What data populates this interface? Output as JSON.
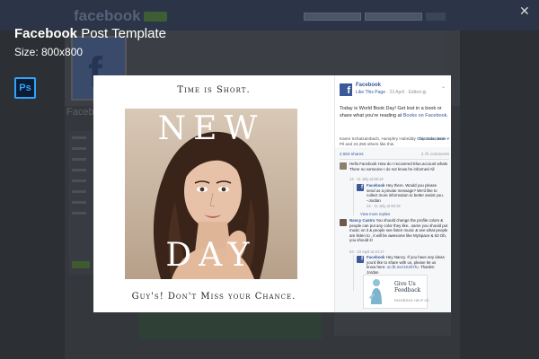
{
  "background": {
    "logo": "facebook",
    "page_name": "Facebo"
  },
  "header": {
    "title_bold": "Facebook",
    "title_rest": " Post Template",
    "size_text": "Size: 800x800",
    "app_icon_label": "Ps",
    "close_symbol": "✕"
  },
  "post": {
    "top_text": "Time is Short.",
    "word_top": "NEW",
    "word_bottom": "DAY",
    "bottom_text": "Guy's! Don't Miss your Chance."
  },
  "fb": {
    "logo_letter": "f",
    "page_name": "Facebook",
    "like_label": "Like This Page",
    "date": "23 April",
    "edited": "Edited",
    "text_prefix": "Today is World Book Day! Get lost in a book or share what you're reading at ",
    "text_link": "Books on Facebook",
    "text_suffix": ".",
    "likes_text": "Karen Schatzambach, Humphry Hubriddy Chiconda, Jose Pil and 24,255 others like this.",
    "top_comments": "Top Comments ▾",
    "shares": "2,663 shares",
    "comments_count": "2.7k comments",
    "comments": [
      {
        "name": "",
        "text": "Hello Facebook How do I recovered Elue.account whats There no someone I do not know he informed All"
      },
      {
        "meta": "14 · 11 July at 06:13"
      },
      {
        "name": "Facebook",
        "text": "Hey there. Would you please send us a private message? We'd like to collect more information to better assist you. –Jordan"
      },
      {
        "meta": "14 · 11 July at 06:19"
      },
      {
        "more": "View more replies"
      },
      {
        "name": "Nancy Castro",
        "text": "You should change the profile colors & people can put any color they like...same you should put music on it & people see listen music & see what people are listen to , it will be awesome like MySpace & 53 Ob, you should it!"
      },
      {
        "meta": "24 · 23 April at 10:17"
      },
      {
        "name": "Facebook",
        "text": "Hey Nancy. If you have any ideas you'd like to share with us, please let us know here: ",
        "link": "on.fb.me/1K2kYfu",
        "suffix": ". Thanks! Jordan"
      }
    ],
    "ad_line1": "Give Us",
    "ad_line2": "Feedback",
    "ad_line3": "FACEBOOK HELP CE"
  }
}
